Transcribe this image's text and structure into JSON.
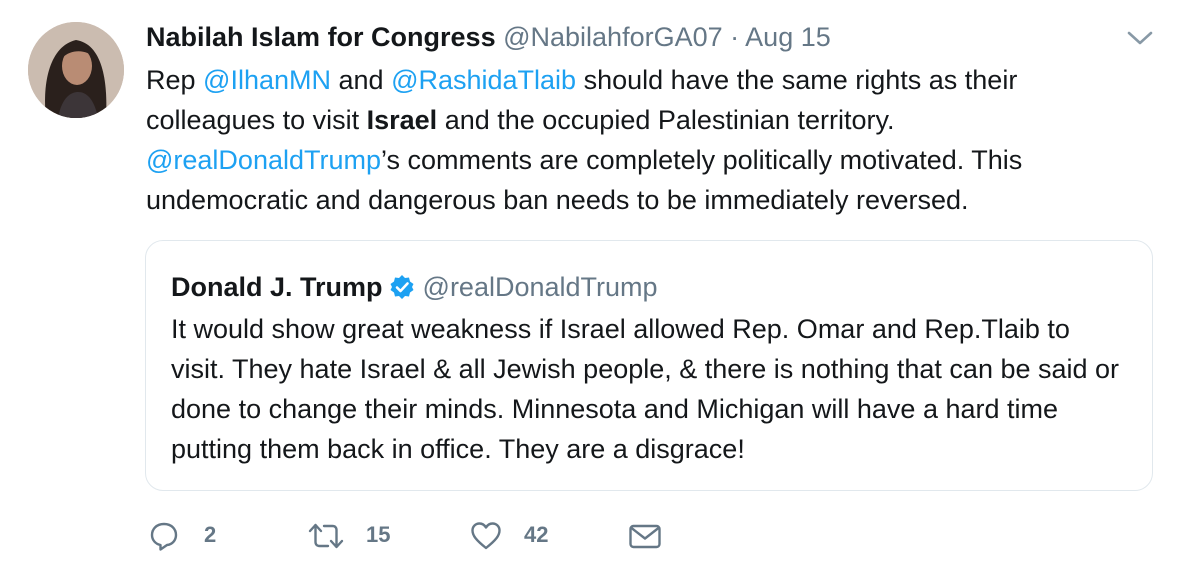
{
  "tweet": {
    "author_name": "Nabilah Islam for Congress",
    "author_handle": "@NabilahforGA07",
    "separator": "·",
    "time": "Aug 15",
    "text": {
      "t1": "Rep ",
      "m1": "@IlhanMN",
      "t2": " and ",
      "m2": "@RashidaTlaib",
      "t3": " should have the same rights as their colleagues to visit ",
      "b1": "Israel",
      "t4": " and the occupied Palestinian territory. ",
      "m3": "@realDonaldTrump",
      "t5": "’s comments are completely politically motivated. This undemocratic and dangerous ban needs to be immediately reversed."
    }
  },
  "quoted": {
    "author_name": "Donald J. Trump",
    "author_handle": "@realDonaldTrump",
    "text": "It would show great weakness if Israel allowed Rep. Omar and Rep.Tlaib to visit. They hate Israel & all Jewish people, & there is nothing that can be said or done to change their minds. Minnesota and Michigan will have a hard time putting them back in office. They are a disgrace!"
  },
  "actions": {
    "reply": {
      "icon": "reply-icon",
      "count": "2"
    },
    "retweet": {
      "icon": "retweet-icon",
      "count": "15"
    },
    "like": {
      "icon": "heart-icon",
      "count": "42"
    },
    "dm": {
      "icon": "envelope-icon"
    }
  },
  "icons": {
    "caret": "chevron-down-icon",
    "verified": "verified-badge-icon"
  },
  "colors": {
    "link": "#1da1f2",
    "muted": "#657786",
    "border": "#e1e8ed",
    "text": "#14171a"
  }
}
